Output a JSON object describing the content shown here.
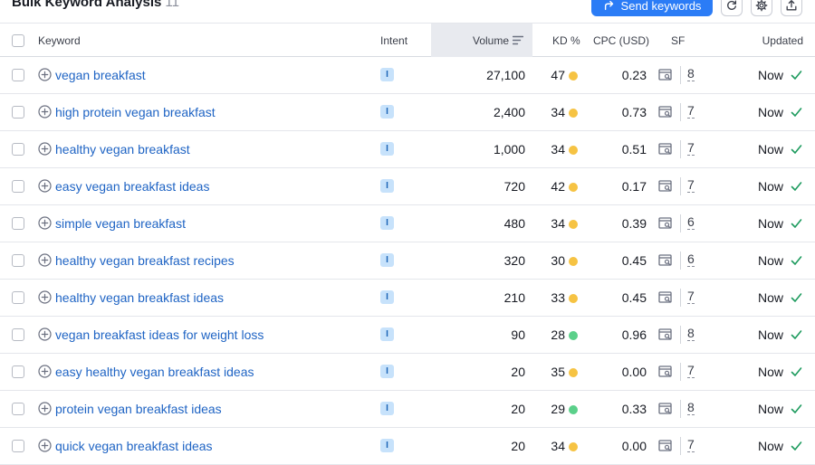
{
  "header": {
    "title": "Bulk Keyword Analysis",
    "count": "11",
    "send_label": "Send keywords",
    "refresh_icon": "refresh-icon",
    "settings_icon": "gear-icon",
    "export_icon": "export-icon",
    "accent": "#2b7cf6"
  },
  "columns": {
    "keyword": "Keyword",
    "intent": "Intent",
    "volume": "Volume",
    "kd": "KD %",
    "cpc": "CPC (USD)",
    "sf": "SF",
    "updated": "Updated"
  },
  "colors": {
    "kd_medium": "#f6c343",
    "kd_easy": "#5bd08a",
    "link": "#1f64c4",
    "check": "#1d9b5e"
  },
  "rows": [
    {
      "keyword": "vegan breakfast",
      "intent": "I",
      "volume": "27,100",
      "kd": "47",
      "kd_level": "medium",
      "cpc": "0.23",
      "sf": "8",
      "updated": "Now"
    },
    {
      "keyword": "high protein vegan breakfast",
      "intent": "I",
      "volume": "2,400",
      "kd": "34",
      "kd_level": "medium",
      "cpc": "0.73",
      "sf": "7",
      "updated": "Now"
    },
    {
      "keyword": "healthy vegan breakfast",
      "intent": "I",
      "volume": "1,000",
      "kd": "34",
      "kd_level": "medium",
      "cpc": "0.51",
      "sf": "7",
      "updated": "Now"
    },
    {
      "keyword": "easy vegan breakfast ideas",
      "intent": "I",
      "volume": "720",
      "kd": "42",
      "kd_level": "medium",
      "cpc": "0.17",
      "sf": "7",
      "updated": "Now"
    },
    {
      "keyword": "simple vegan breakfast",
      "intent": "I",
      "volume": "480",
      "kd": "34",
      "kd_level": "medium",
      "cpc": "0.39",
      "sf": "6",
      "updated": "Now"
    },
    {
      "keyword": "healthy vegan breakfast recipes",
      "intent": "I",
      "volume": "320",
      "kd": "30",
      "kd_level": "medium",
      "cpc": "0.45",
      "sf": "6",
      "updated": "Now"
    },
    {
      "keyword": "healthy vegan breakfast ideas",
      "intent": "I",
      "volume": "210",
      "kd": "33",
      "kd_level": "medium",
      "cpc": "0.45",
      "sf": "7",
      "updated": "Now"
    },
    {
      "keyword": "vegan breakfast ideas for weight loss",
      "intent": "I",
      "volume": "90",
      "kd": "28",
      "kd_level": "easy",
      "cpc": "0.96",
      "sf": "8",
      "updated": "Now"
    },
    {
      "keyword": "easy healthy vegan breakfast ideas",
      "intent": "I",
      "volume": "20",
      "kd": "35",
      "kd_level": "medium",
      "cpc": "0.00",
      "sf": "7",
      "updated": "Now"
    },
    {
      "keyword": "protein vegan breakfast ideas",
      "intent": "I",
      "volume": "20",
      "kd": "29",
      "kd_level": "easy",
      "cpc": "0.33",
      "sf": "8",
      "updated": "Now"
    },
    {
      "keyword": "quick vegan breakfast ideas",
      "intent": "I",
      "volume": "20",
      "kd": "34",
      "kd_level": "medium",
      "cpc": "0.00",
      "sf": "7",
      "updated": "Now"
    }
  ]
}
